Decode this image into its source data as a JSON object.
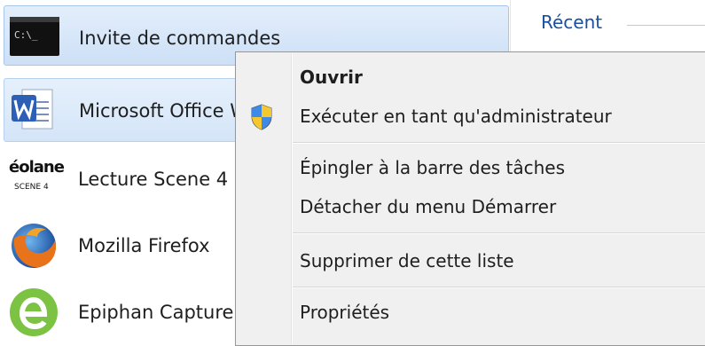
{
  "start_menu": {
    "programs": [
      {
        "label": "Invite de commandes",
        "icon": "cmd-icon"
      },
      {
        "label": "Microsoft Office W",
        "icon": "word-icon"
      },
      {
        "label": "Lecture Scene 4",
        "icon": "eolane-scene4-icon",
        "icon_text_top": "éolane",
        "icon_text_bottom": "SCENE 4"
      },
      {
        "label": "Mozilla Firefox",
        "icon": "firefox-icon"
      },
      {
        "label": "Epiphan Capture",
        "icon": "epiphan-icon"
      }
    ],
    "cmd_icon_text": "C:\\_"
  },
  "right_pane": {
    "recent_label": "Récent"
  },
  "context_menu": {
    "items": [
      {
        "label": "Ouvrir"
      },
      {
        "label": "Exécuter en tant qu'administrateur",
        "icon": "uac-shield-icon"
      },
      {
        "label": "Épingler à la barre des tâches"
      },
      {
        "label": "Détacher du menu Démarrer"
      },
      {
        "label": "Supprimer de cette liste"
      },
      {
        "label": "Propriétés"
      }
    ]
  }
}
